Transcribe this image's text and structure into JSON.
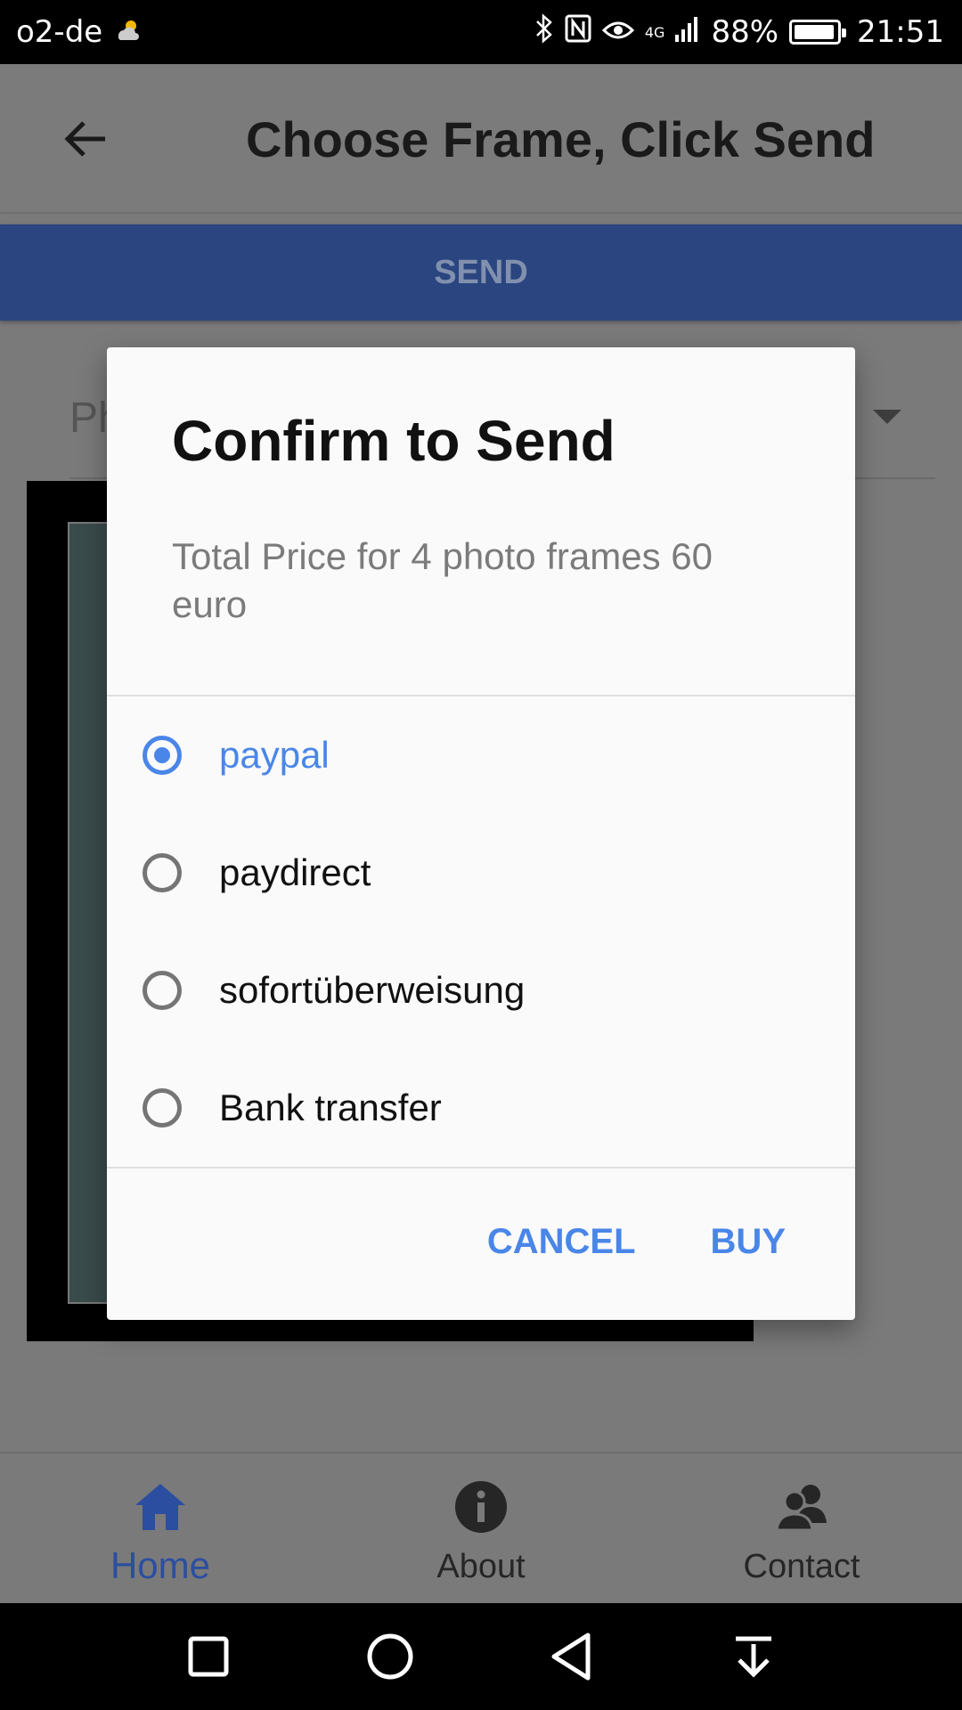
{
  "status_bar": {
    "carrier": "o2-de",
    "battery": "88%",
    "time": "21:51",
    "network": "4G"
  },
  "app_bar": {
    "title": "Choose Frame, Click Send"
  },
  "send_button": "SEND",
  "dropdown": {
    "visible_text": "Ph"
  },
  "dialog": {
    "title": "Confirm to Send",
    "message": "Total Price for 4 photo frames 60 euro",
    "options": [
      {
        "label": "paypal",
        "selected": true
      },
      {
        "label": "paydirect",
        "selected": false
      },
      {
        "label": "sofortüberweisung",
        "selected": false
      },
      {
        "label": "Bank transfer",
        "selected": false
      }
    ],
    "cancel": "CANCEL",
    "buy": "BUY"
  },
  "bottom_nav": [
    {
      "label": "Home",
      "icon": "home-icon",
      "active": true
    },
    {
      "label": "About",
      "icon": "info-icon",
      "active": false
    },
    {
      "label": "Contact",
      "icon": "contacts-icon",
      "active": false
    }
  ],
  "colors": {
    "accent": "#4a86e8",
    "send_bar": "#2a4580",
    "nav_active": "#2c4ea0"
  }
}
